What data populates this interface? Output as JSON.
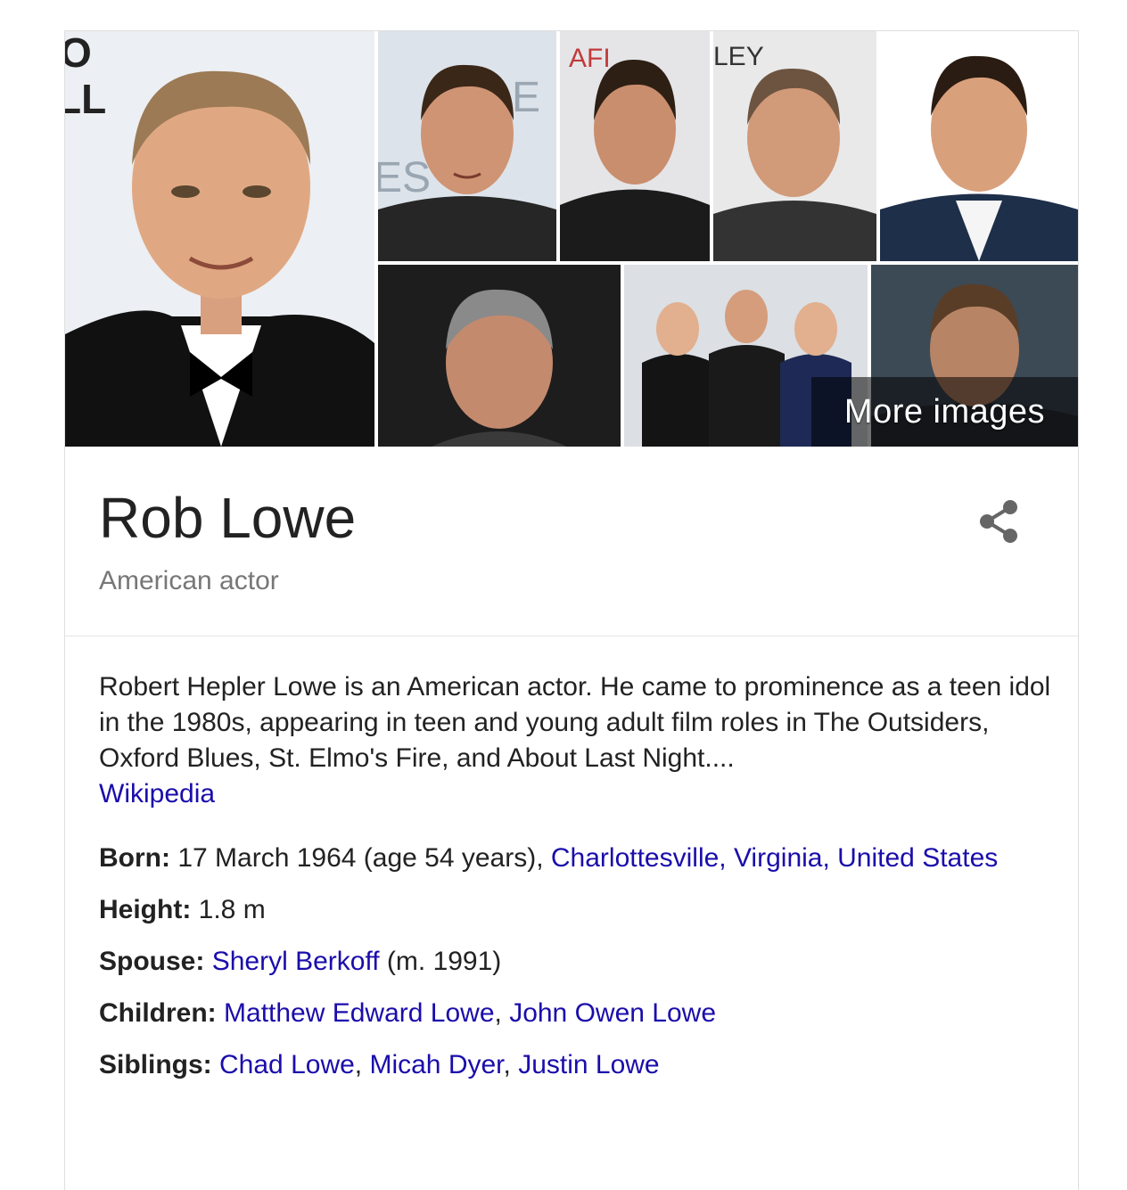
{
  "images": {
    "more_images_label": "More images"
  },
  "entity": {
    "title": "Rob Lowe",
    "subtitle": "American actor"
  },
  "description": {
    "text": "Robert Hepler Lowe is an American actor. He came to prominence as a teen idol in the 1980s, appearing in teen and young adult film roles in The Outsiders, Oxford Blues, St. Elmo's Fire, and About Last Night....",
    "source_link": "Wikipedia"
  },
  "facts": {
    "born": {
      "label": "Born:",
      "value": " 17 March 1964 (age 54 years), ",
      "link": "Charlottesville, Virginia, United States"
    },
    "height": {
      "label": "Height:",
      "value": " 1.8 m"
    },
    "spouse": {
      "label": "Spouse:",
      "link": "Sheryl Berkoff",
      "suffix": " (m. 1991)"
    },
    "children": {
      "label": "Children:",
      "items": [
        "Matthew Edward Lowe",
        "John Owen Lowe"
      ],
      "sep": ", "
    },
    "siblings": {
      "label": "Siblings:",
      "items": [
        "Chad Lowe",
        "Micah Dyer",
        "Justin Lowe"
      ],
      "sep1": ", ",
      "sep2": ", "
    }
  },
  "colors": {
    "link": "#1a0dab",
    "text": "#222222",
    "muted": "#777777",
    "divider": "#e6e6e6"
  }
}
